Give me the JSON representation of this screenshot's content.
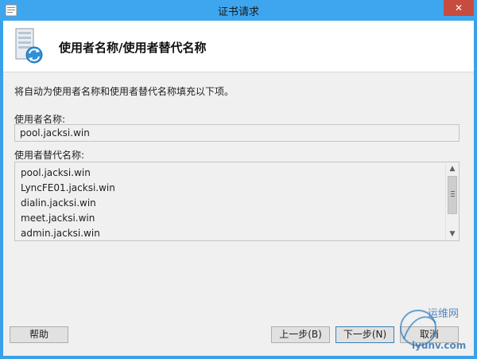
{
  "window": {
    "title": "证书请求",
    "close_label": "✕"
  },
  "header": {
    "title": "使用者名称/使用者替代名称"
  },
  "main": {
    "description": "将自动为使用者名称和使用者替代名称填充以下项。",
    "subject_label": "使用者名称:",
    "subject_value": "pool.jacksi.win",
    "alt_label": "使用者替代名称:",
    "alt_names": [
      "pool.jacksi.win",
      "LyncFE01.jacksi.win",
      "dialin.jacksi.win",
      "meet.jacksi.win",
      "admin.jacksi.win"
    ]
  },
  "buttons": {
    "help": "帮助",
    "back": "上一步(B)",
    "next": "下一步(N)",
    "cancel": "取消"
  },
  "watermark": {
    "site": "运维网",
    "url": "iyunv.com"
  },
  "colors": {
    "titlebar": "#3ea6ef",
    "close": "#c74b3f",
    "client": "#f0f0f0"
  }
}
